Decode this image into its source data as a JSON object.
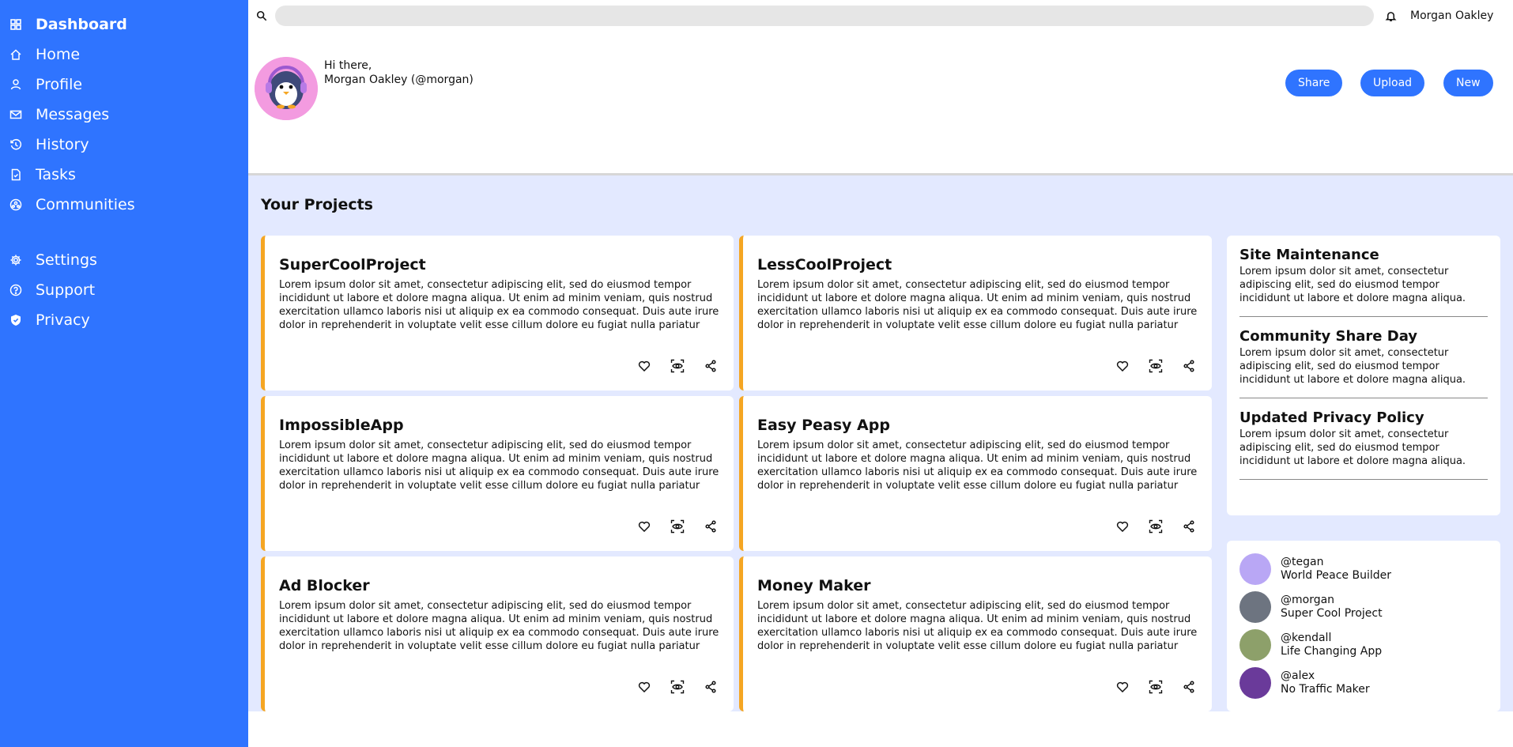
{
  "sidebar": {
    "brand": "Dashboard",
    "items": [
      {
        "label": "Home",
        "icon": "home-icon"
      },
      {
        "label": "Profile",
        "icon": "user-icon"
      },
      {
        "label": "Messages",
        "icon": "mail-icon"
      },
      {
        "label": "History",
        "icon": "history-icon"
      },
      {
        "label": "Tasks",
        "icon": "document-icon"
      },
      {
        "label": "Communities",
        "icon": "community-icon"
      }
    ],
    "secondary": [
      {
        "label": "Settings",
        "icon": "gear-icon"
      },
      {
        "label": "Support",
        "icon": "help-icon"
      },
      {
        "label": "Privacy",
        "icon": "shield-icon"
      }
    ]
  },
  "header": {
    "search_placeholder": "",
    "user_name": "Morgan Oakley"
  },
  "greeting": {
    "line1": "Hi there,",
    "line2": "Morgan Oakley (@morgan)",
    "buttons": {
      "share": "Share",
      "upload": "Upload",
      "new": "New"
    }
  },
  "projects": {
    "title": "Your Projects",
    "items": [
      {
        "name": "SuperCoolProject",
        "desc": "Lorem ipsum dolor sit amet, consectetur adipiscing elit, sed do eiusmod tempor incididunt ut labore et dolore magna aliqua. Ut enim ad minim veniam, quis nostrud exercitation ullamco laboris nisi ut aliquip ex ea commodo consequat. Duis aute irure dolor in reprehenderit in voluptate velit esse cillum dolore eu fugiat nulla pariatur"
      },
      {
        "name": "LessCoolProject",
        "desc": "Lorem ipsum dolor sit amet, consectetur adipiscing elit, sed do eiusmod tempor incididunt ut labore et dolore magna aliqua. Ut enim ad minim veniam, quis nostrud exercitation ullamco laboris nisi ut aliquip ex ea commodo consequat. Duis aute irure dolor in reprehenderit in voluptate velit esse cillum dolore eu fugiat nulla pariatur"
      },
      {
        "name": "ImpossibleApp",
        "desc": "Lorem ipsum dolor sit amet, consectetur adipiscing elit, sed do eiusmod tempor incididunt ut labore et dolore magna aliqua. Ut enim ad minim veniam, quis nostrud exercitation ullamco laboris nisi ut aliquip ex ea commodo consequat. Duis aute irure dolor in reprehenderit in voluptate velit esse cillum dolore eu fugiat nulla pariatur"
      },
      {
        "name": "Easy Peasy App",
        "desc": "Lorem ipsum dolor sit amet, consectetur adipiscing elit, sed do eiusmod tempor incididunt ut labore et dolore magna aliqua. Ut enim ad minim veniam, quis nostrud exercitation ullamco laboris nisi ut aliquip ex ea commodo consequat. Duis aute irure dolor in reprehenderit in voluptate velit esse cillum dolore eu fugiat nulla pariatur"
      },
      {
        "name": "Ad Blocker",
        "desc": "Lorem ipsum dolor sit amet, consectetur adipiscing elit, sed do eiusmod tempor incididunt ut labore et dolore magna aliqua. Ut enim ad minim veniam, quis nostrud exercitation ullamco laboris nisi ut aliquip ex ea commodo consequat. Duis aute irure dolor in reprehenderit in voluptate velit esse cillum dolore eu fugiat nulla pariatur"
      },
      {
        "name": "Money Maker",
        "desc": "Lorem ipsum dolor sit amet, consectetur adipiscing elit, sed do eiusmod tempor incididunt ut labore et dolore magna aliqua. Ut enim ad minim veniam, quis nostrud exercitation ullamco laboris nisi ut aliquip ex ea commodo consequat. Duis aute irure dolor in reprehenderit in voluptate velit esse cillum dolore eu fugiat nulla pariatur"
      }
    ]
  },
  "announcements": [
    {
      "title": "Site Maintenance",
      "body": "Lorem ipsum dolor sit amet, consectetur adipiscing elit, sed do eiusmod tempor incididunt ut labore et dolore magna aliqua."
    },
    {
      "title": "Community Share Day",
      "body": "Lorem ipsum dolor sit amet, consectetur adipiscing elit, sed do eiusmod tempor incididunt ut labore et dolore magna aliqua."
    },
    {
      "title": "Updated Privacy Policy",
      "body": "Lorem ipsum dolor sit amet, consectetur adipiscing elit, sed do eiusmod tempor incididunt ut labore et dolore magna aliqua."
    }
  ],
  "trending": [
    {
      "handle": "@tegan",
      "project": "World Peace Builder",
      "color": "#b9a7f5"
    },
    {
      "handle": "@morgan",
      "project": "Super Cool Project",
      "color": "#6d7480"
    },
    {
      "handle": "@kendall",
      "project": "Life Changing App",
      "color": "#8da06a"
    },
    {
      "handle": "@alex",
      "project": "No Traffic Maker",
      "color": "#6a3a9a"
    }
  ],
  "colors": {
    "accent": "#2f74ff",
    "card_border": "#f5a623",
    "main_bg": "#e3e9ff",
    "avatar_bg": "#f39be0"
  }
}
